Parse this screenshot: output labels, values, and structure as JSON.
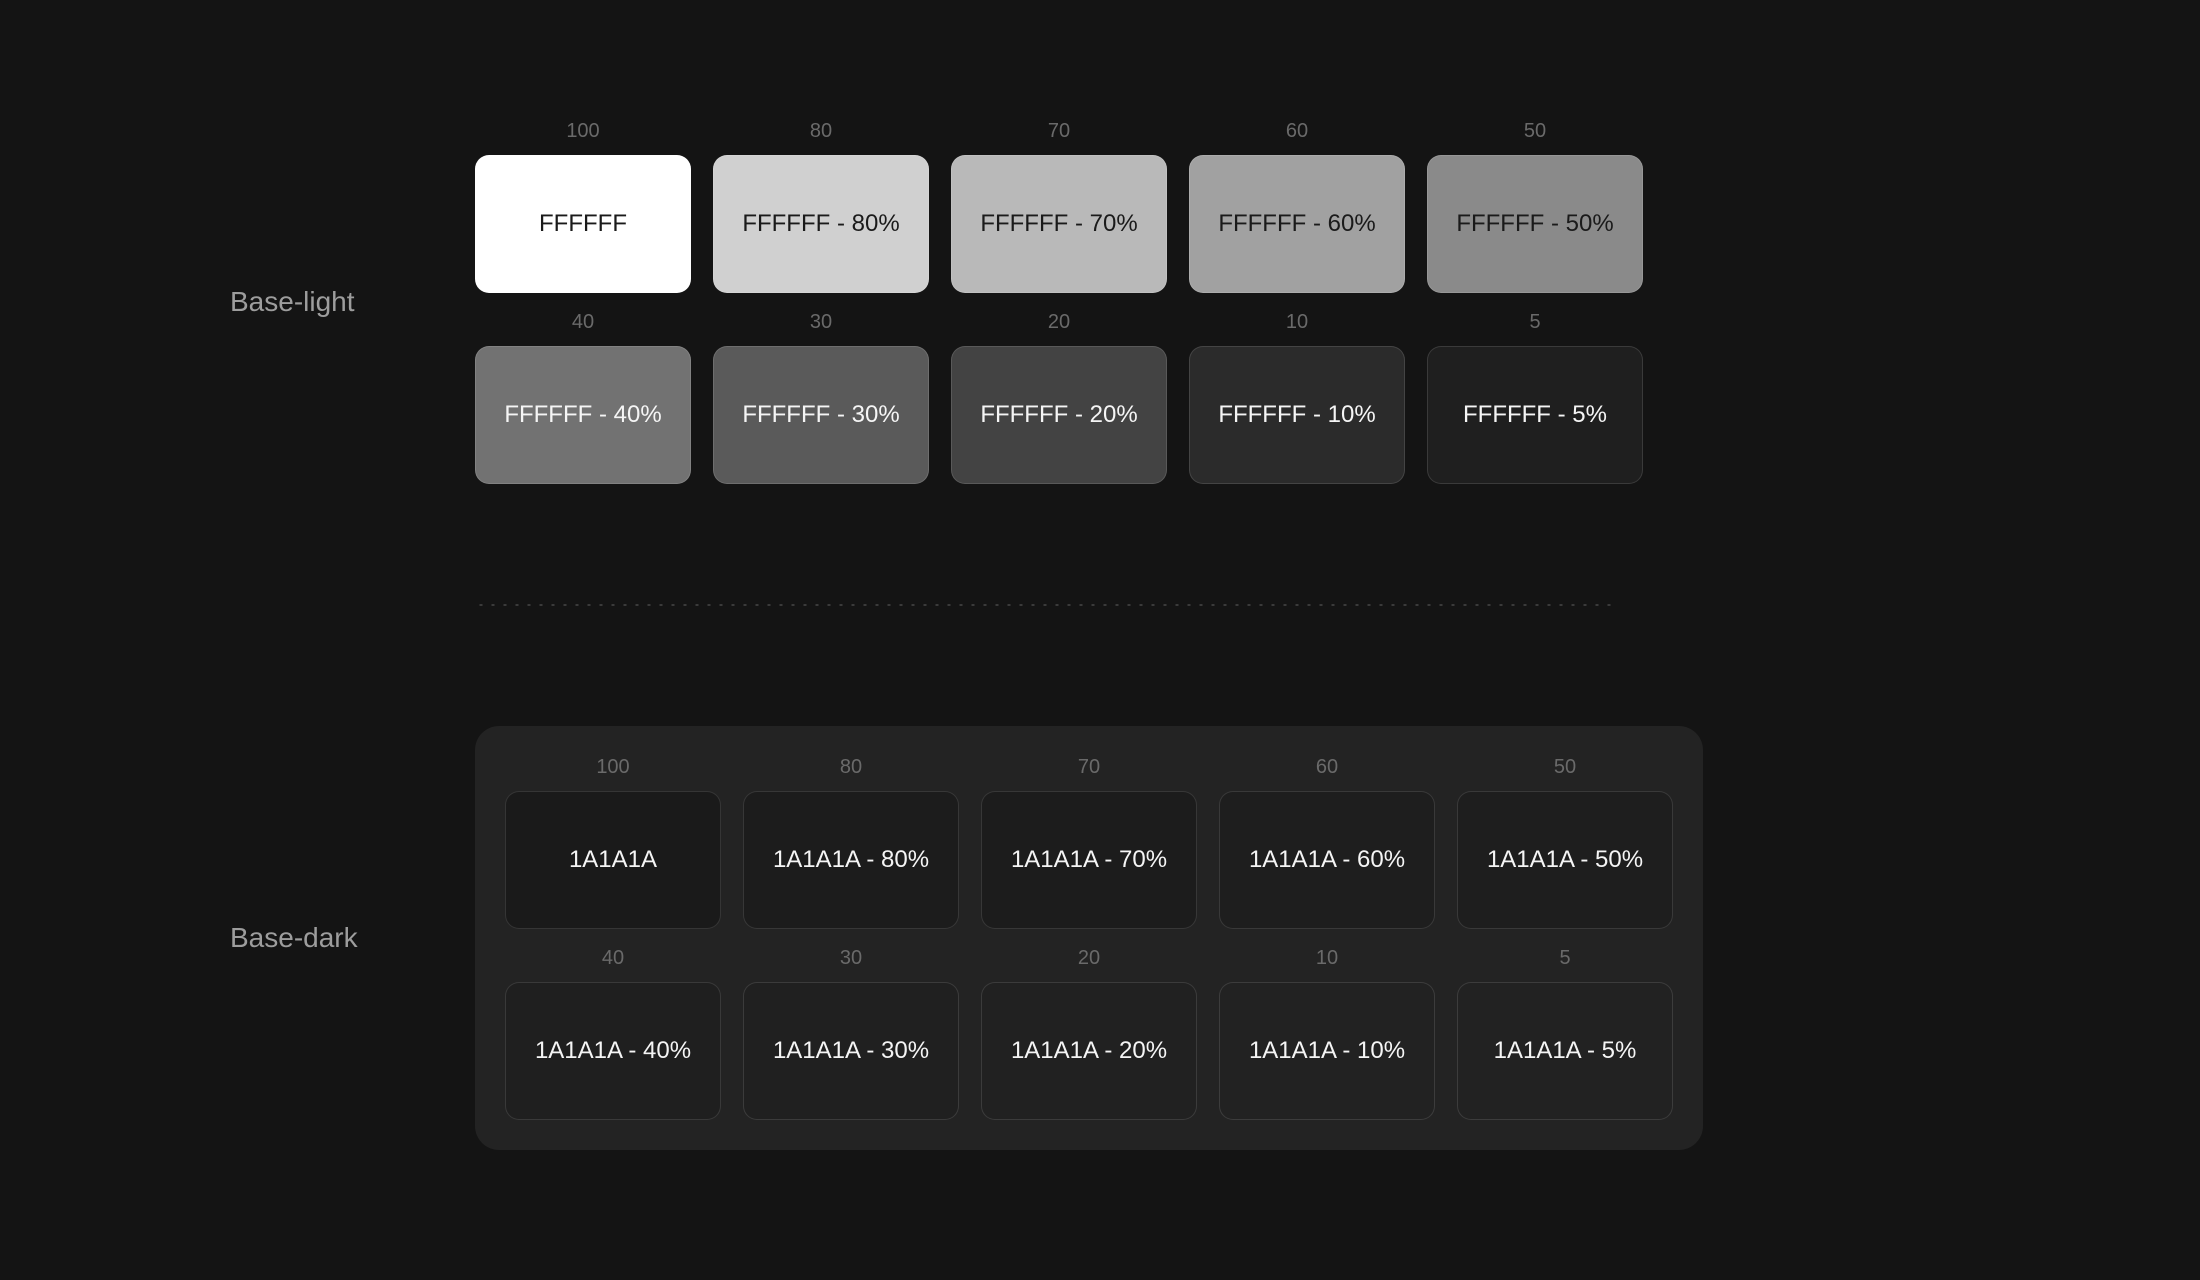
{
  "sections": {
    "light": {
      "label": "Base-light",
      "base_hex": "FFFFFF",
      "swatches": [
        {
          "num": "100",
          "label": "FFFFFF",
          "bg": "#FFFFFF",
          "fg": "#1a1a1a"
        },
        {
          "num": "80",
          "label": "FFFFFF - 80%",
          "bg": "rgba(255,255,255,0.80)",
          "fg": "#1a1a1a"
        },
        {
          "num": "70",
          "label": "FFFFFF - 70%",
          "bg": "rgba(255,255,255,0.70)",
          "fg": "#1a1a1a"
        },
        {
          "num": "60",
          "label": "FFFFFF - 60%",
          "bg": "rgba(255,255,255,0.60)",
          "fg": "#1a1a1a"
        },
        {
          "num": "50",
          "label": "FFFFFF - 50%",
          "bg": "rgba(255,255,255,0.50)",
          "fg": "#1a1a1a"
        },
        {
          "num": "40",
          "label": "FFFFFF - 40%",
          "bg": "rgba(255,255,255,0.40)",
          "fg": "#f5f5f5"
        },
        {
          "num": "30",
          "label": "FFFFFF - 30%",
          "bg": "rgba(255,255,255,0.30)",
          "fg": "#f5f5f5"
        },
        {
          "num": "20",
          "label": "FFFFFF - 20%",
          "bg": "rgba(255,255,255,0.20)",
          "fg": "#f5f5f5"
        },
        {
          "num": "10",
          "label": "FFFFFF - 10%",
          "bg": "rgba(255,255,255,0.10)",
          "fg": "#f5f5f5"
        },
        {
          "num": "5",
          "label": "FFFFFF - 5%",
          "bg": "rgba(255,255,255,0.05)",
          "fg": "#f5f5f5"
        }
      ]
    },
    "dark": {
      "label": "Base-dark",
      "base_hex": "1A1A1A",
      "swatches": [
        {
          "num": "100",
          "label": "1A1A1A",
          "bg": "#1A1A1A",
          "fg": "#f5f5f5"
        },
        {
          "num": "80",
          "label": "1A1A1A - 80%",
          "bg": "rgba(26,26,26,0.80)",
          "fg": "#f5f5f5"
        },
        {
          "num": "70",
          "label": "1A1A1A - 70%",
          "bg": "rgba(26,26,26,0.70)",
          "fg": "#f5f5f5"
        },
        {
          "num": "60",
          "label": "1A1A1A - 60%",
          "bg": "rgba(26,26,26,0.60)",
          "fg": "#f5f5f5"
        },
        {
          "num": "50",
          "label": "1A1A1A - 50%",
          "bg": "rgba(26,26,26,0.50)",
          "fg": "#f5f5f5"
        },
        {
          "num": "40",
          "label": "1A1A1A - 40%",
          "bg": "rgba(26,26,26,0.40)",
          "fg": "#f5f5f5"
        },
        {
          "num": "30",
          "label": "1A1A1A - 30%",
          "bg": "rgba(26,26,26,0.30)",
          "fg": "#f5f5f5"
        },
        {
          "num": "20",
          "label": "1A1A1A - 20%",
          "bg": "rgba(26,26,26,0.20)",
          "fg": "#f5f5f5"
        },
        {
          "num": "10",
          "label": "1A1A1A - 10%",
          "bg": "rgba(26,26,26,0.10)",
          "fg": "#f5f5f5"
        },
        {
          "num": "5",
          "label": "1A1A1A - 5%",
          "bg": "rgba(26,26,26,0.05)",
          "fg": "#f5f5f5"
        }
      ]
    }
  }
}
